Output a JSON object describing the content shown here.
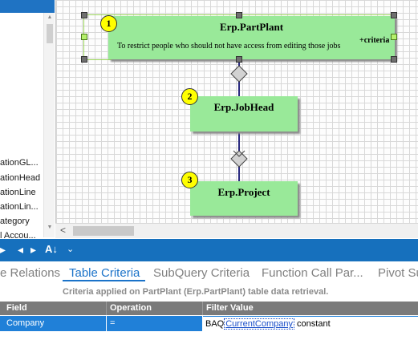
{
  "tree": {
    "items": [
      "ationGL...",
      "ationHead",
      "ationLine",
      "ationLin...",
      "ategory",
      "l Accou..."
    ]
  },
  "diagram": {
    "nodes": [
      {
        "number": "1",
        "title": "Erp.PartPlant",
        "note": "To restrict people who should not have access from editing those jobs",
        "tag": "+criteria"
      },
      {
        "number": "2",
        "title": "Erp.JobHead"
      },
      {
        "number": "3",
        "title": "Erp.Project"
      }
    ]
  },
  "toolbar": {
    "buttons": [
      "back-arrow",
      "nav-left",
      "nav-right",
      "sort-az",
      "dropdown"
    ]
  },
  "tabs": [
    {
      "label": "e Relations"
    },
    {
      "label": "Table Criteria",
      "active": true
    },
    {
      "label": "SubQuery Criteria"
    },
    {
      "label": "Function Call Par..."
    },
    {
      "label": "Pivot Su"
    }
  ],
  "criteria_note": "Criteria applied on PartPlant (Erp.PartPlant)  table data retrieval.",
  "grid": {
    "columns": [
      "Field",
      "Operation",
      "Filter Value"
    ],
    "rows": [
      {
        "field": "Company",
        "operation": "=",
        "filter_prefix": "BAQ",
        "filter_link": "CurrentCompany",
        "filter_suffix": " constant"
      }
    ]
  },
  "colors": {
    "accent": "#1670bd",
    "node_fill": "#99e999",
    "badge": "#ffff00",
    "selected_cell": "#2080d8"
  }
}
